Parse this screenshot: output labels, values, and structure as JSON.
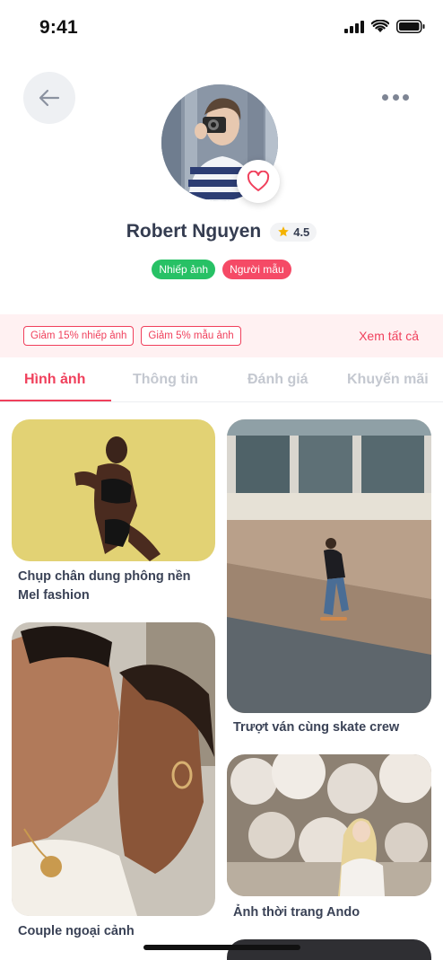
{
  "status_bar": {
    "time": "9:41"
  },
  "profile": {
    "name": "Robert Nguyen",
    "rating": "4.5",
    "tags": [
      "Nhiếp ảnh",
      "Người mẫu"
    ]
  },
  "promo": {
    "coupons": [
      "Giảm 15% nhiếp ảnh",
      "Giảm 5% mẫu ảnh"
    ],
    "see_all": "Xem tất cả"
  },
  "tabs": [
    {
      "label": "Hình ảnh",
      "active": true
    },
    {
      "label": "Thông tin",
      "active": false
    },
    {
      "label": "Đánh giá",
      "active": false
    },
    {
      "label": "Khuyến mãi",
      "active": false
    }
  ],
  "gallery": {
    "left": [
      {
        "caption": "Chụp chân dung phông nền Mel fashion"
      },
      {
        "caption": "Couple ngoại cảnh"
      }
    ],
    "right": [
      {
        "caption": "Trượt ván cùng skate crew"
      },
      {
        "caption": "Ảnh thời trang Ando"
      }
    ]
  },
  "colors": {
    "accent": "#f0405c",
    "green": "#27c165",
    "text": "#343c50"
  }
}
